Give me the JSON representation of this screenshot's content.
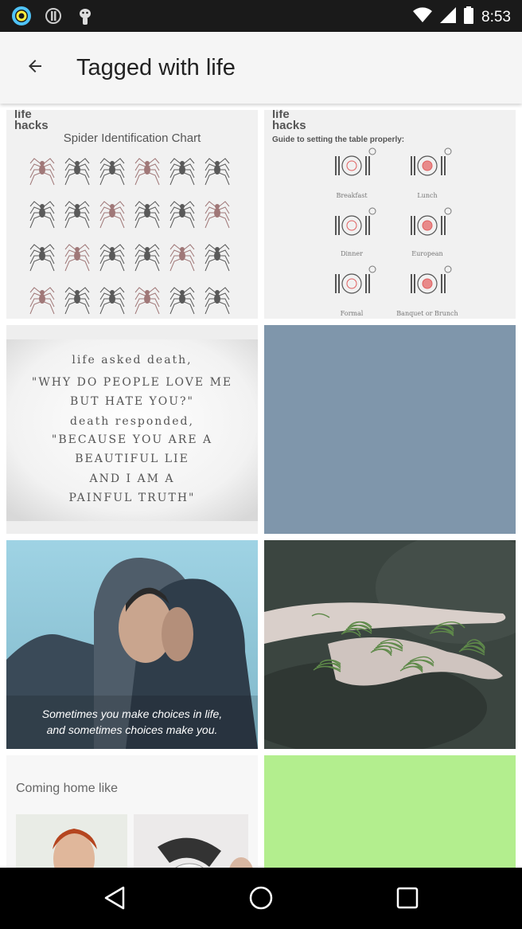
{
  "status_bar": {
    "time": "8:53",
    "icons": [
      "ring-app-icon",
      "info-icon",
      "android-icon"
    ]
  },
  "app_bar": {
    "back_icon": "arrow-back-icon",
    "title": "Tagged with life"
  },
  "grid": {
    "tiles": [
      {
        "kind": "image",
        "text": "Spider Identification Chart",
        "brand": "life hacks"
      },
      {
        "kind": "image",
        "text": "Guide to setting the table properly:",
        "brand": "life hacks",
        "labels": [
          "Breakfast",
          "Lunch",
          "Dinner",
          "European",
          "Formal",
          "Banquet or Brunch"
        ]
      },
      {
        "kind": "image",
        "lines": [
          "life asked death,",
          "\"WHY DO PEOPLE LOVE ME",
          "BUT HATE YOU?\"",
          "death responded,",
          "\"BECAUSE YOU ARE A",
          "BEAUTIFUL LIE",
          "AND I AM A",
          "PAINFUL TRUTH\""
        ]
      },
      {
        "kind": "placeholder",
        "color": "#7f96ab"
      },
      {
        "kind": "image",
        "lines": [
          "Sometimes you make choices in life,",
          "and sometimes choices make you."
        ]
      },
      {
        "kind": "image"
      },
      {
        "kind": "image",
        "text": "Coming home like"
      },
      {
        "kind": "placeholder",
        "color": "#b3ee8e"
      }
    ]
  },
  "nav_bar": {
    "icons": [
      "back-triangle-icon",
      "home-circle-icon",
      "recents-square-icon"
    ]
  }
}
